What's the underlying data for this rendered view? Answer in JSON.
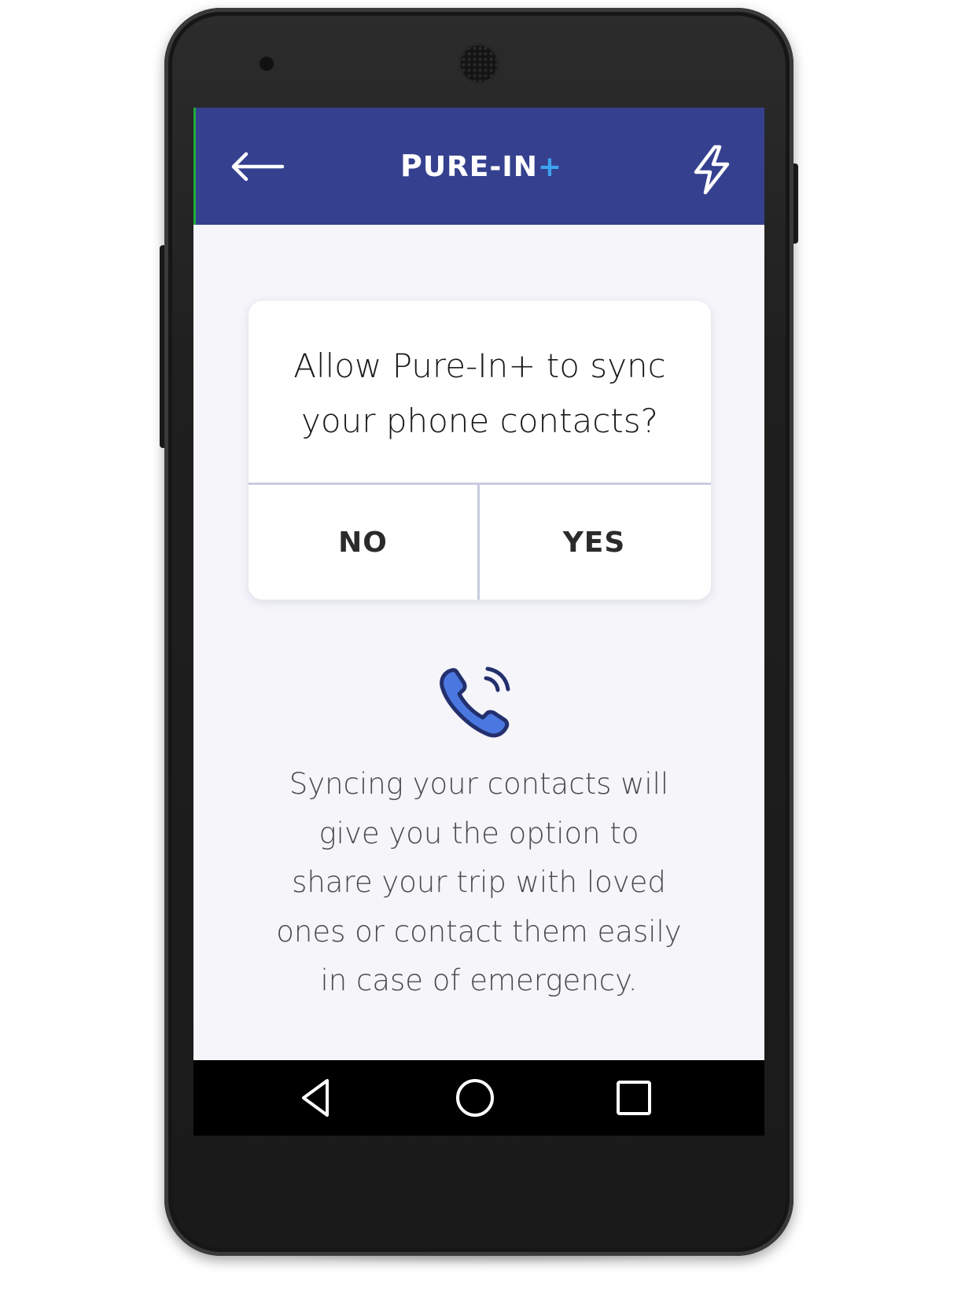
{
  "app": {
    "title_parts": {
      "first": "P",
      "rest": "URE-IN",
      "plus": "+"
    }
  },
  "dialog": {
    "question": "Allow Pure-In+ to sync\nyour phone contacts?",
    "no_label": "NO",
    "yes_label": "YES"
  },
  "info": {
    "text": "Syncing your contacts will\ngive you the option to\nshare your trip with loved\nones or contact them easily\nin case of emergency."
  },
  "icons": {
    "back": "arrow-left-icon",
    "flash": "lightning-icon",
    "contacts": "phone-call-icon",
    "nav_back": "triangle-back-icon",
    "nav_home": "circle-home-icon",
    "nav_recent": "square-recents-icon"
  },
  "colors": {
    "appbar": "#35418f",
    "accent": "#3da3f0",
    "phone_icon_fill": "#4a78e0",
    "phone_icon_stroke": "#23306e"
  }
}
